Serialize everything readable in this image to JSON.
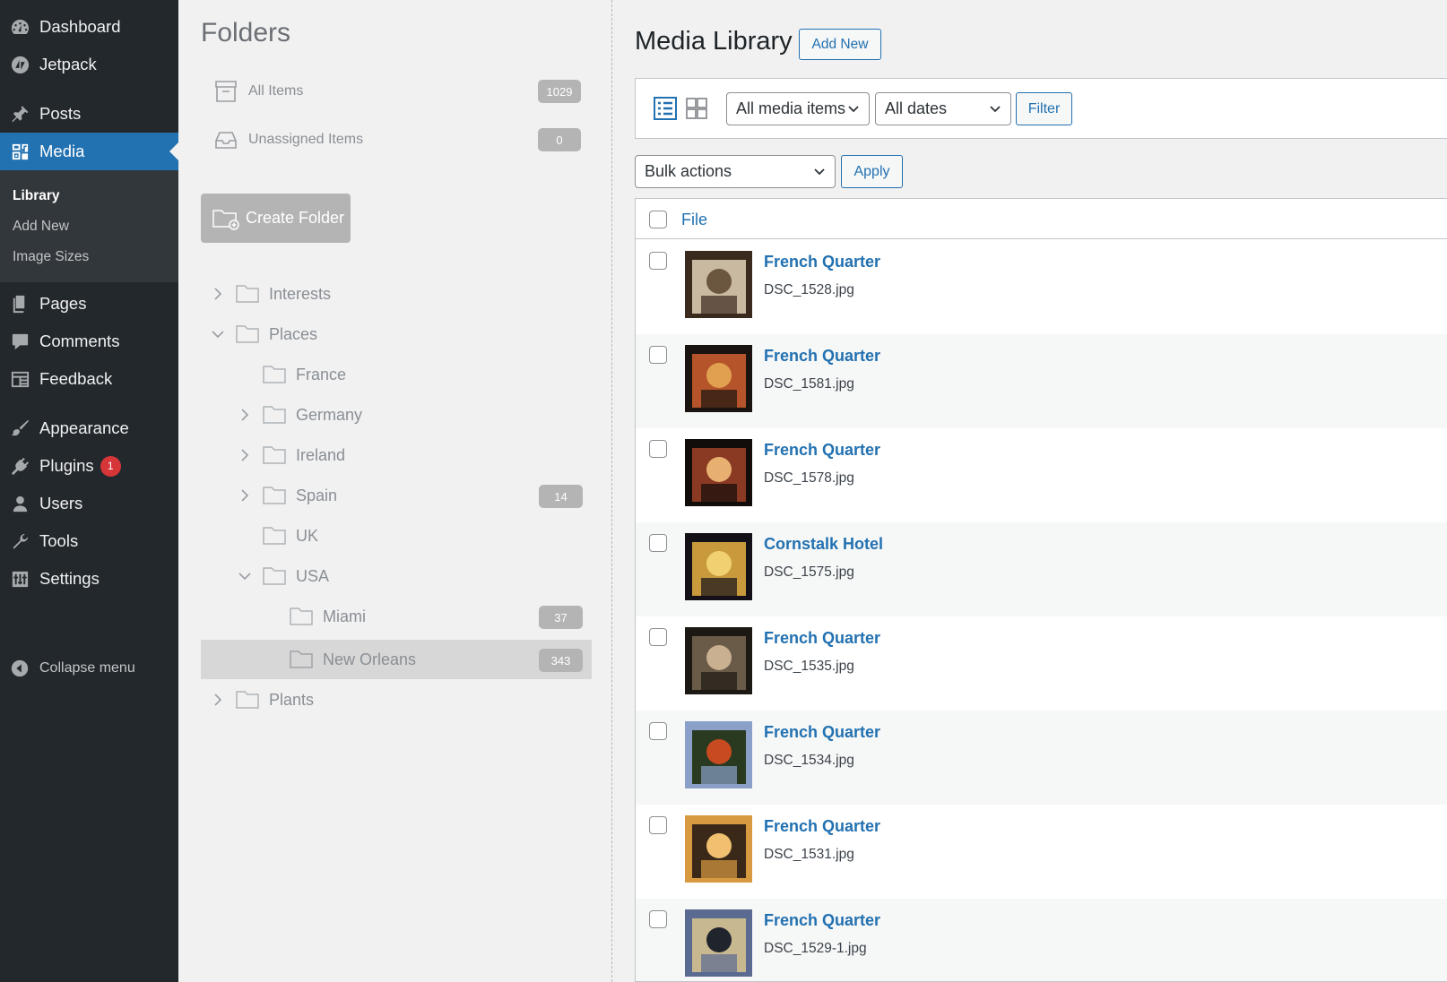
{
  "admin_menu": {
    "items": [
      {
        "label": "Dashboard",
        "icon": "dashboard-icon"
      },
      {
        "label": "Jetpack",
        "icon": "jetpack-icon"
      },
      {
        "label": "Posts",
        "icon": "pin-icon"
      },
      {
        "label": "Media",
        "icon": "media-icon",
        "current": true
      },
      {
        "label": "Pages",
        "icon": "pages-icon"
      },
      {
        "label": "Comments",
        "icon": "comment-icon"
      },
      {
        "label": "Feedback",
        "icon": "feedback-icon"
      },
      {
        "label": "Appearance",
        "icon": "brush-icon"
      },
      {
        "label": "Plugins",
        "icon": "plug-icon",
        "badge": "1"
      },
      {
        "label": "Users",
        "icon": "user-icon"
      },
      {
        "label": "Tools",
        "icon": "wrench-icon"
      },
      {
        "label": "Settings",
        "icon": "settings-icon"
      }
    ],
    "submenu": [
      "Library",
      "Add New",
      "Image Sizes"
    ],
    "collapse_label": "Collapse menu"
  },
  "folders": {
    "title": "Folders",
    "all_items": {
      "label": "All Items",
      "count": "1029"
    },
    "unassigned": {
      "label": "Unassigned Items",
      "count": "0"
    },
    "create_label": "Create Folder",
    "tree": [
      {
        "label": "Interests",
        "count": ""
      },
      {
        "label": "Places",
        "count": ""
      },
      {
        "label": "France",
        "count": ""
      },
      {
        "label": "Germany",
        "count": ""
      },
      {
        "label": "Ireland",
        "count": ""
      },
      {
        "label": "Spain",
        "count": "14"
      },
      {
        "label": "UK",
        "count": ""
      },
      {
        "label": "USA",
        "count": ""
      },
      {
        "label": "Miami",
        "count": "37"
      },
      {
        "label": "New Orleans",
        "count": "343"
      },
      {
        "label": "Plants",
        "count": ""
      }
    ]
  },
  "main": {
    "title": "Media Library",
    "add_new": "Add New",
    "media_filter": "All media items",
    "date_filter": "All dates",
    "filter_button": "Filter",
    "bulk_actions": "Bulk actions",
    "apply_button": "Apply",
    "column_file": "File",
    "rows": [
      {
        "title": "French Quarter",
        "file": "DSC_1528.jpg",
        "colors": [
          "#3a2a1e",
          "#c9b9a0",
          "#6b5640"
        ]
      },
      {
        "title": "French Quarter",
        "file": "DSC_1581.jpg",
        "colors": [
          "#1a1410",
          "#b5542a",
          "#e0a050"
        ]
      },
      {
        "title": "French Quarter",
        "file": "DSC_1578.jpg",
        "colors": [
          "#120d0b",
          "#8a3a22",
          "#e8b070"
        ]
      },
      {
        "title": "Cornstalk Hotel",
        "file": "DSC_1575.jpg",
        "colors": [
          "#141018",
          "#c89a3c",
          "#f0d070"
        ]
      },
      {
        "title": "French Quarter",
        "file": "DSC_1535.jpg",
        "colors": [
          "#1c1814",
          "#6a5a48",
          "#c8b090"
        ]
      },
      {
        "title": "French Quarter",
        "file": "DSC_1534.jpg",
        "colors": [
          "#8aa0c8",
          "#2a3a20",
          "#c84a20"
        ]
      },
      {
        "title": "French Quarter",
        "file": "DSC_1531.jpg",
        "colors": [
          "#d89a40",
          "#3a2818",
          "#f0c070"
        ]
      },
      {
        "title": "French Quarter",
        "file": "DSC_1529-1.jpg",
        "colors": [
          "#5a6a90",
          "#c8b890",
          "#20242c"
        ]
      }
    ]
  }
}
